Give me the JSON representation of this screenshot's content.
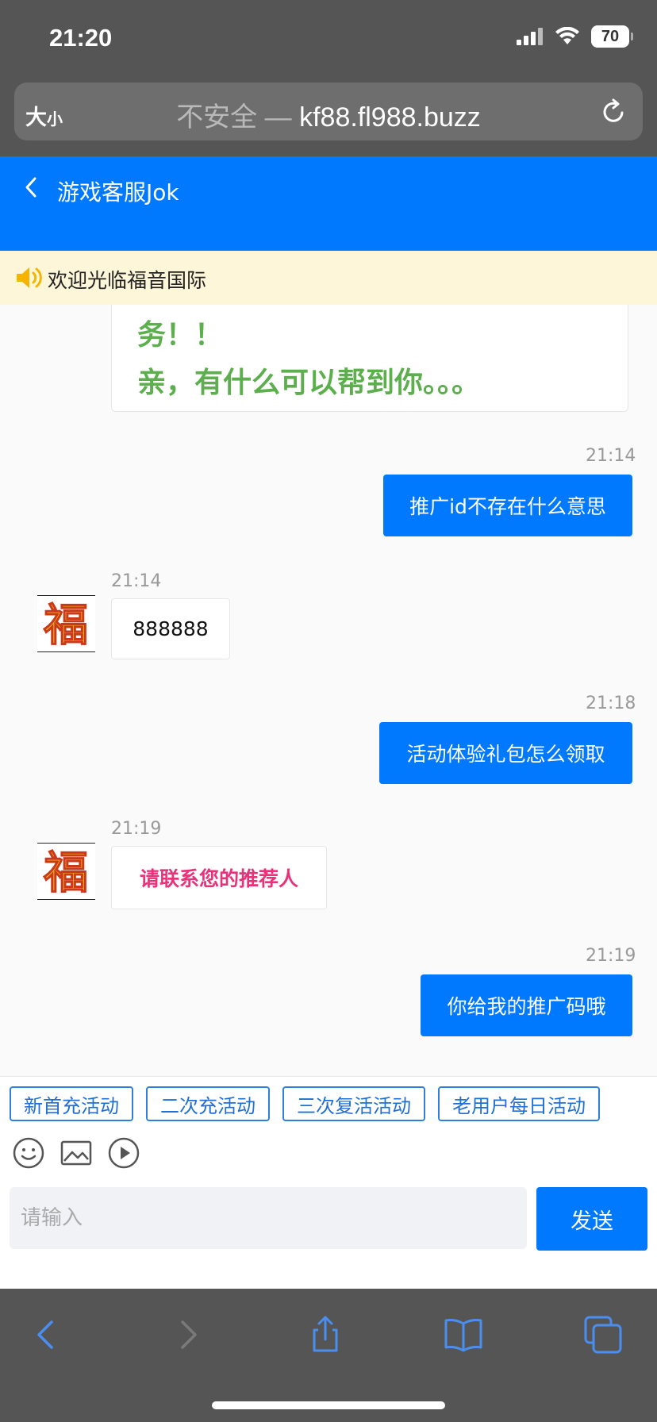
{
  "status_bar": {
    "time": "21:20",
    "battery": "70"
  },
  "browser": {
    "font_size_label_large": "大",
    "font_size_label_small": "小",
    "url_insecure": "不安全 — ",
    "url_domain": "kf88.fl988.buzz"
  },
  "header": {
    "title": "游戏客服Jok"
  },
  "notice": {
    "text": "欢迎光临福音国际"
  },
  "chat": {
    "welcome_lines": [
      "务！！",
      "亲，有什么可以帮到你。。。"
    ],
    "messages": [
      {
        "side": "right",
        "time": "21:14",
        "text": "推广id不存在什么意思"
      },
      {
        "side": "left",
        "time": "21:14",
        "text": "888888"
      },
      {
        "side": "right",
        "time": "21:18",
        "text": "活动体验礼包怎么领取"
      },
      {
        "side": "left",
        "time": "21:19",
        "text": "请联系您的推荐人"
      },
      {
        "side": "right",
        "time": "21:19",
        "text": "你给我的推广码哦"
      }
    ],
    "avatar_char": "福"
  },
  "quick_replies": [
    "新首充活动",
    "二次充活动",
    "三次复活活动",
    "老用户每日活动"
  ],
  "input": {
    "placeholder": "请输入",
    "send_label": "发送"
  },
  "colors": {
    "brand_blue": "#0079fe",
    "notice_bg": "#fdf6d8",
    "welcome_green": "#5daf4e",
    "pink_text": "#e8327a"
  }
}
